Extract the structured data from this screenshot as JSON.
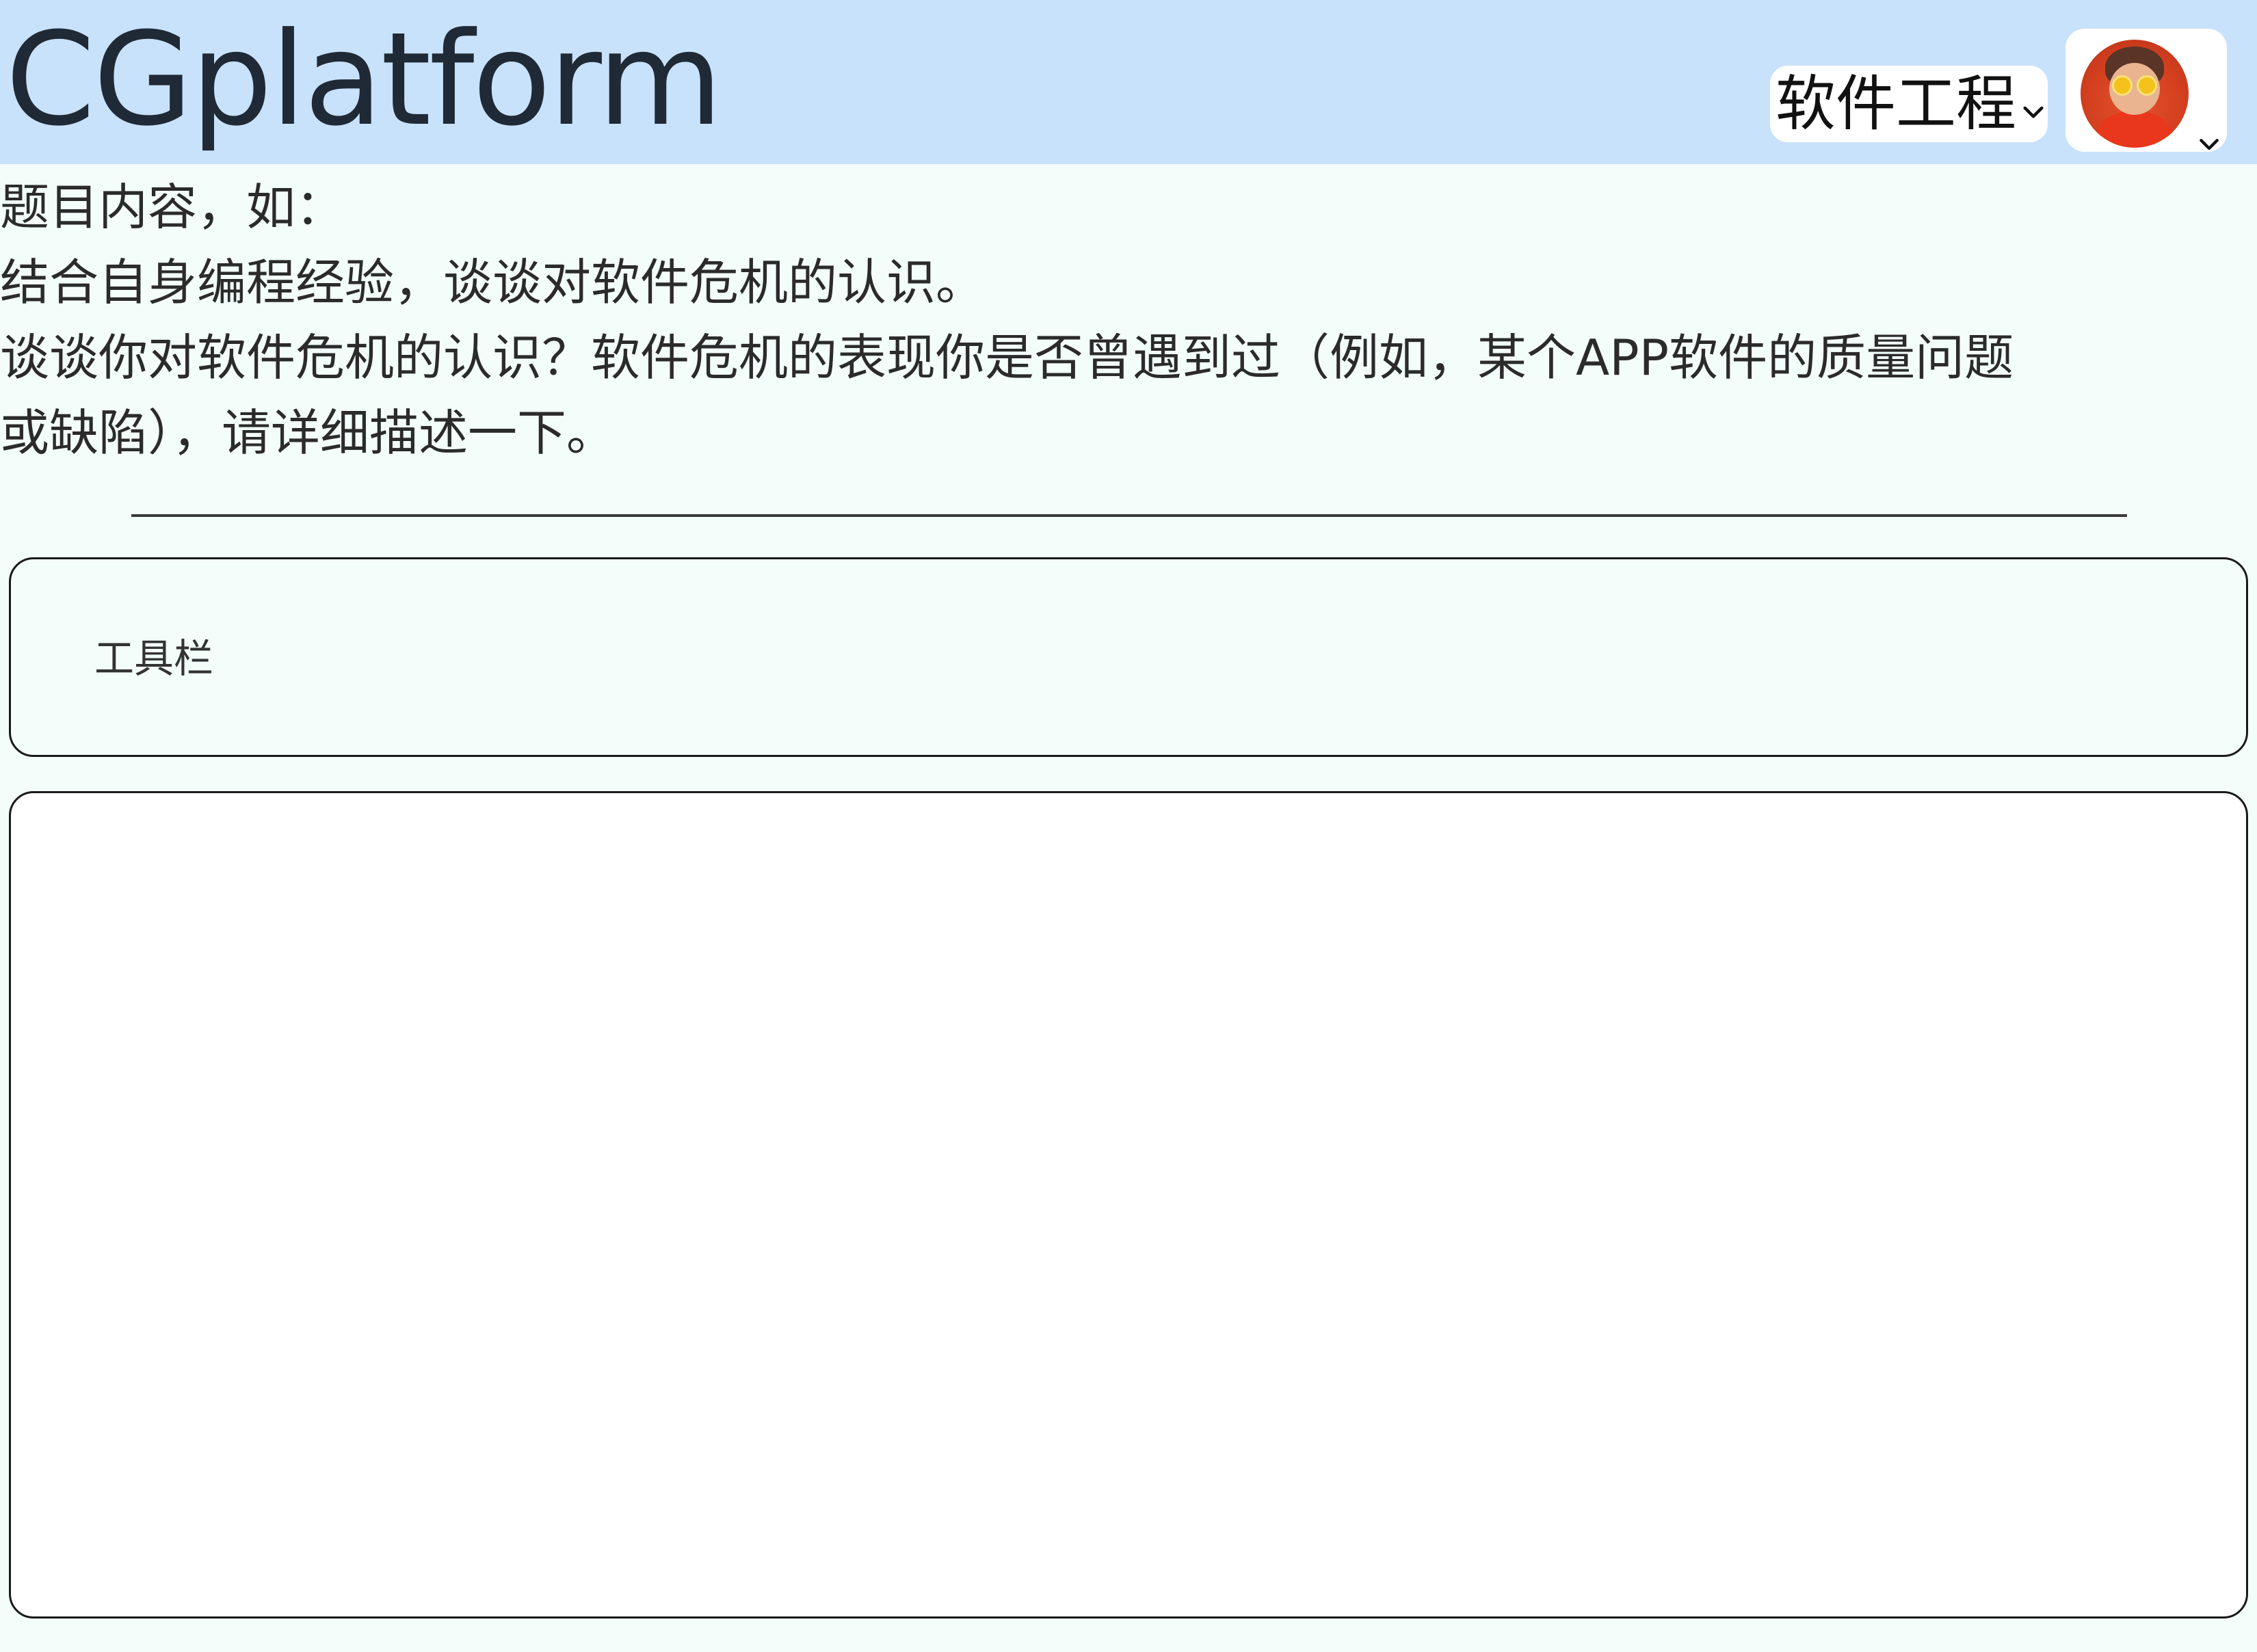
{
  "header": {
    "logo": "CGplatform",
    "course_select": {
      "selected": "软件工程"
    },
    "user_menu": {
      "avatar": "avatar-photo"
    },
    "background": "#c9e2fb"
  },
  "question": {
    "intro": "题目内容，如：",
    "line1": "结合自身编程经验，谈谈对软件危机的认识。",
    "line2": "谈谈你对软件危机的认识？软件危机的表现你是否曾遇到过（例如，某个APP软件的质量问题",
    "line3": "或缺陷），请详细描述一下。"
  },
  "toolbar": {
    "label": "工具栏"
  },
  "editor": {
    "content": ""
  },
  "colors": {
    "page_background": "#f3fefb",
    "header_background": "#c9e2fb",
    "editor_background": "#ffffff"
  }
}
